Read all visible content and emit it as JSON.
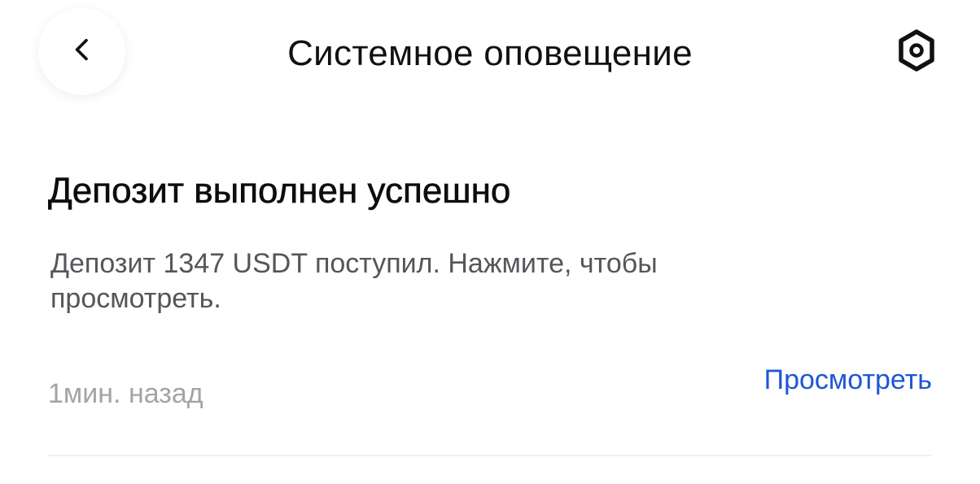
{
  "header": {
    "back_icon": "chevron-left-icon",
    "title": "Системное оповещение",
    "settings_icon": "hexagon-gear-icon"
  },
  "notification": {
    "title": "Депозит выполнен успешно",
    "body": "Депозит 1347 USDT поступил. Нажмите, чтобы просмотреть.",
    "time": "1мин. назад",
    "action_label": "Просмотреть"
  },
  "colors": {
    "link": "#1f56d6",
    "body_text": "#55565a",
    "muted_text": "#a3a4a8",
    "divider": "#eff0f2"
  }
}
